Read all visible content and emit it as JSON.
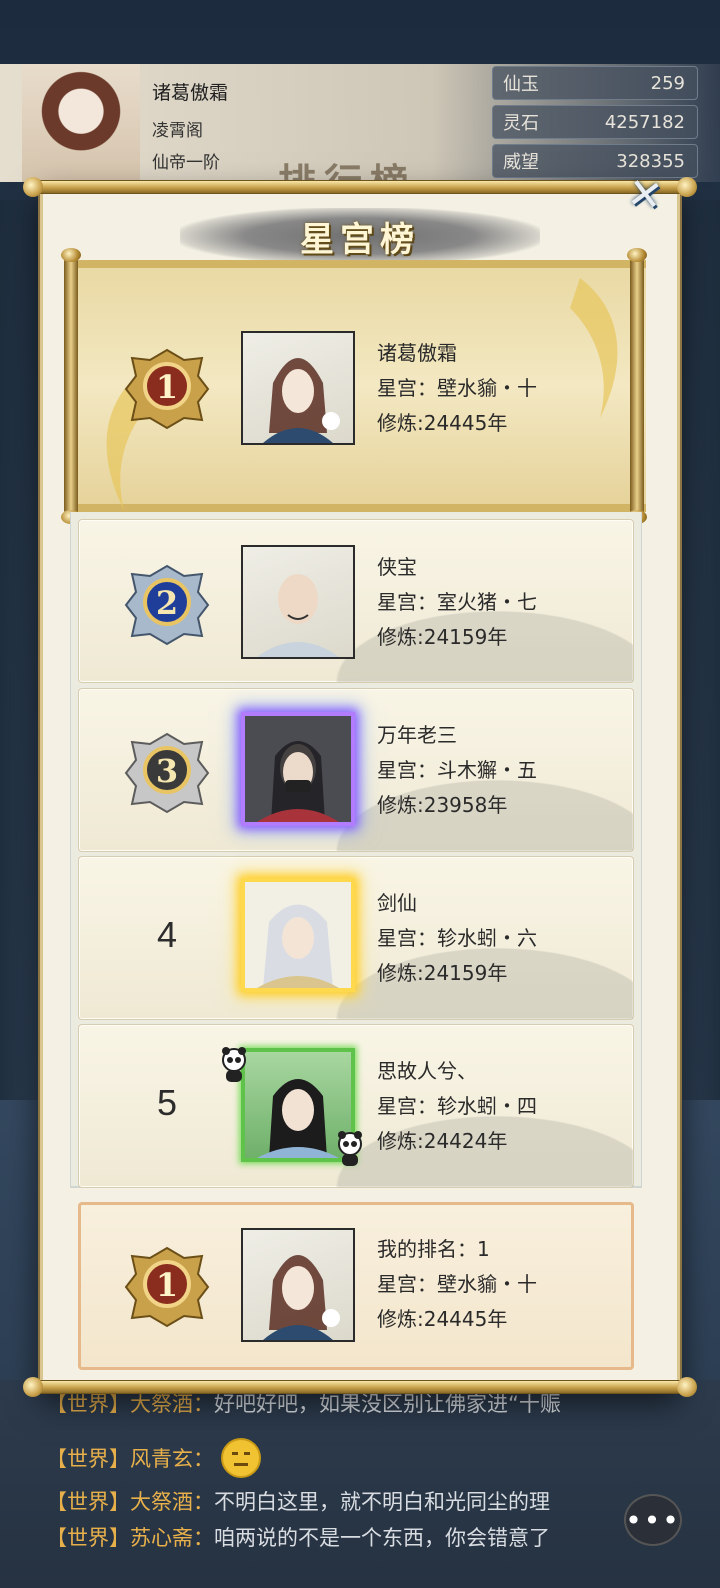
{
  "player": {
    "name": "诸葛傲霜",
    "sect": "凌霄阁",
    "realm": "仙帝一阶"
  },
  "resources": [
    {
      "label": "仙玉",
      "value": "259"
    },
    {
      "label": "灵石",
      "value": "4257182"
    },
    {
      "label": "威望",
      "value": "328355"
    }
  ],
  "background": {
    "title": "排行榜"
  },
  "modal": {
    "title": "星宫榜",
    "close_icon": "close-x-icon"
  },
  "entries": [
    {
      "rank": "1",
      "name": "诸葛傲霜",
      "star": "星宫：壁水貐・十",
      "cultivation": "修炼:24445年",
      "medal": "gold"
    },
    {
      "rank": "2",
      "name": "侠宝",
      "star": "星宫：室火猪・七",
      "cultivation": "修炼:24159年",
      "medal": "blue"
    },
    {
      "rank": "3",
      "name": "万年老三",
      "star": "星宫：斗木獬・五",
      "cultivation": "修炼:23958年",
      "medal": "silver"
    },
    {
      "rank": "4",
      "name": "剑仙",
      "star": "星宫：轸水蚓・六",
      "cultivation": "修炼:24159年"
    },
    {
      "rank": "5",
      "name": "思故人兮、",
      "star": "星宫：轸水蚓・四",
      "cultivation": "修炼:24424年"
    }
  ],
  "my_rank": {
    "rank": "1",
    "label": "我的排名：1",
    "star": "星宫：壁水貐・十",
    "cultivation": "修炼:24445年"
  },
  "chat": [
    {
      "channel": "【世界】",
      "who": "大祭酒：",
      "text": "好吧好吧，如果没区别让佛家进“十赈"
    },
    {
      "channel": "【世界】",
      "who": "风青玄：",
      "text": ""
    },
    {
      "channel": "【世界】",
      "who": "大祭酒：",
      "text": "不明白这里，就不明白和光同尘的理"
    },
    {
      "channel": "【世界】",
      "who": "苏心斋：",
      "text": "咱两说的不是一个东西，你会错意了"
    }
  ],
  "colors": {
    "accent_gold": "#c9a14b",
    "chat_channel": "#e8b04b",
    "modal_bg": "#f4f1e4"
  }
}
